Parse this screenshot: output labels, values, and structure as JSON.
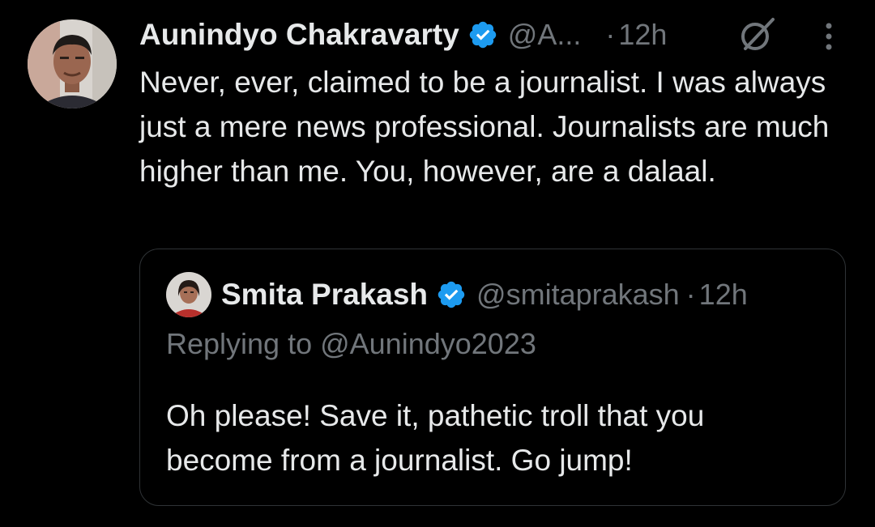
{
  "tweet": {
    "author_name": "Aunindyo Chakravarty",
    "handle": "@A...",
    "separator": "·",
    "time": "12h",
    "text": "Never, ever, claimed to be a journalist. I was always just a mere news professional. Journalists are much higher than me. You, however, are a dalaal.",
    "icons": {
      "verified": "verified-badge-icon",
      "grok": "grok-icon",
      "more": "more-options-icon"
    }
  },
  "quoted_tweet": {
    "author_name": "Smita Prakash",
    "handle": "@smitaprakash",
    "separator": "·",
    "time": "12h",
    "replying_to": "Replying to @Aunindyo2023",
    "text": "Oh please! Save it, pathetic troll that you become from a journalist. Go jump!"
  },
  "colors": {
    "background": "#000000",
    "primary_text": "#e7e9ea",
    "secondary_text": "#71767b",
    "verified_blue": "#1d9bf0",
    "border": "#2f3336"
  }
}
